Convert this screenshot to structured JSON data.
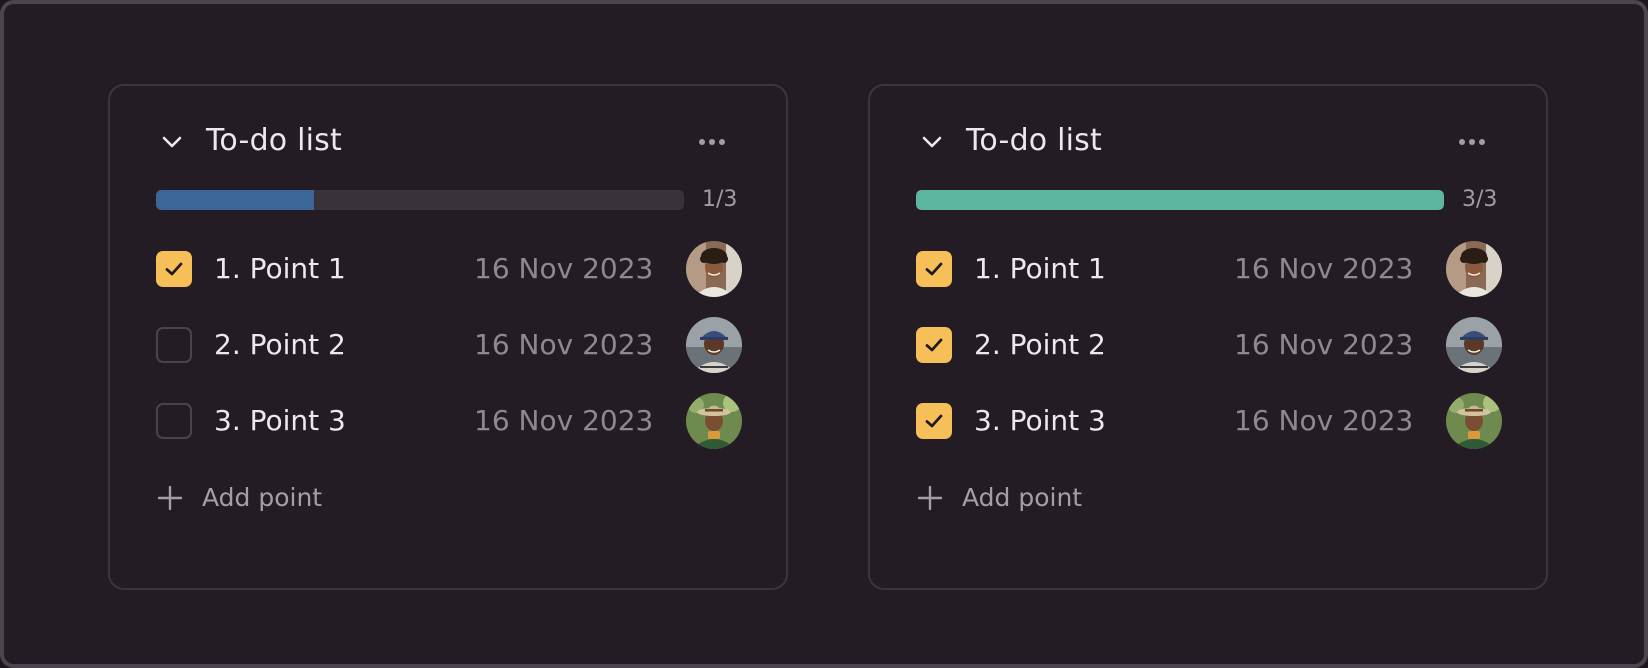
{
  "colors": {
    "background": "#231c24",
    "checkbox_checked": "#f7bf57",
    "progress_partial": "#3d6698",
    "progress_complete": "#5db7a0",
    "progress_track": "#3a323b"
  },
  "lists": [
    {
      "title": "To-do list",
      "collapse_icon": "chevron-down-icon",
      "more_icon": "more-horizontal-icon",
      "progress": {
        "done": 1,
        "total": 3,
        "fraction": 0.3,
        "label": "1/3",
        "color": "#3d6698"
      },
      "items": [
        {
          "label": "1. Point 1",
          "date": "16 Nov 2023",
          "checked": true,
          "avatar": "avatar-curly-hair-man"
        },
        {
          "label": "2. Point 2",
          "date": "16 Nov 2023",
          "checked": false,
          "avatar": "avatar-cap-man"
        },
        {
          "label": "3. Point 3",
          "date": "16 Nov 2023",
          "checked": false,
          "avatar": "avatar-hat-man"
        }
      ],
      "add_label": "Add point",
      "add_icon": "plus-icon"
    },
    {
      "title": "To-do list",
      "collapse_icon": "chevron-down-icon",
      "more_icon": "more-horizontal-icon",
      "progress": {
        "done": 3,
        "total": 3,
        "fraction": 1.0,
        "label": "3/3",
        "color": "#5db7a0"
      },
      "items": [
        {
          "label": "1. Point 1",
          "date": "16 Nov 2023",
          "checked": true,
          "avatar": "avatar-curly-hair-man"
        },
        {
          "label": "2. Point 2",
          "date": "16 Nov 2023",
          "checked": true,
          "avatar": "avatar-cap-man"
        },
        {
          "label": "3. Point 3",
          "date": "16 Nov 2023",
          "checked": true,
          "avatar": "avatar-hat-man"
        }
      ],
      "add_label": "Add point",
      "add_icon": "plus-icon"
    }
  ]
}
